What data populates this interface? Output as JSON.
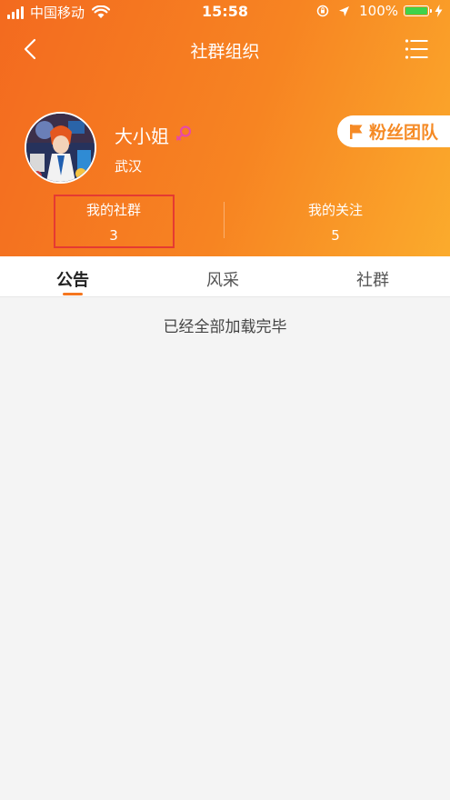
{
  "status_bar": {
    "carrier": "中国移动",
    "time": "15:58",
    "battery": "100%"
  },
  "navbar": {
    "title": "社群组织"
  },
  "profile": {
    "name": "大小姐",
    "city": "武汉",
    "fans_team_label": "粉丝团队"
  },
  "stats": [
    {
      "label": "我的社群",
      "value": "3"
    },
    {
      "label": "我的关注",
      "value": "5"
    }
  ],
  "tabs": [
    {
      "label": "公告"
    },
    {
      "label": "风采"
    },
    {
      "label": "社群"
    }
  ],
  "content": {
    "message": "已经全部加载完毕"
  },
  "colors": {
    "header_start": "#f36a1f",
    "header_end": "#fbab2c",
    "accent": "#f5761f",
    "highlight_box": "#e53a32",
    "gender_icon": "#e84aa6"
  }
}
